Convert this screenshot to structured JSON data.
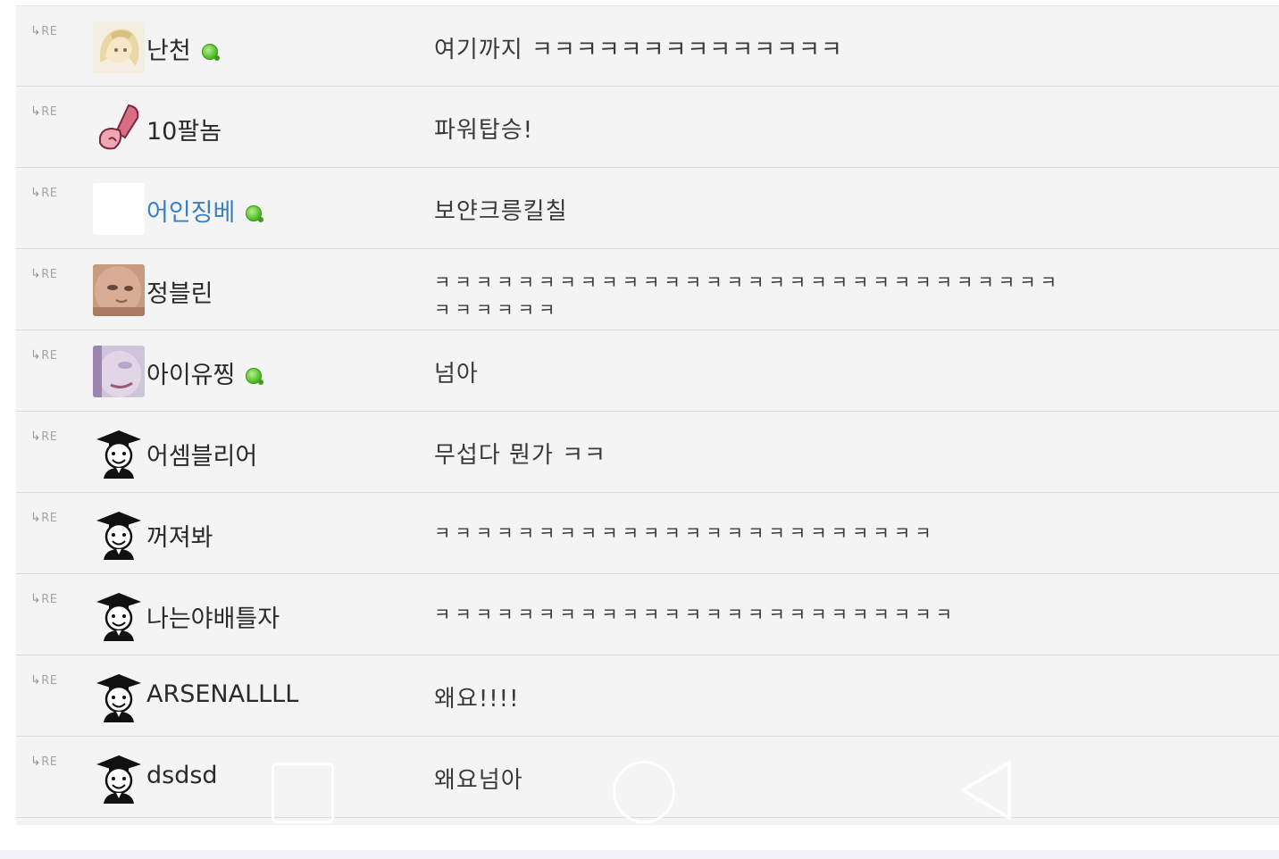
{
  "re_label": "RE",
  "comments": [
    {
      "nickname": "난천",
      "message": "여기까지 ㅋㅋㅋㅋㅋㅋㅋㅋㅋㅋㅋㅋㅋㅋ",
      "online": true,
      "avatar": "blonde-anime-avatar"
    },
    {
      "nickname": "10팔놈",
      "message": "파워탑승!",
      "online": false,
      "avatar": "pink-figure-avatar"
    },
    {
      "nickname": "어인징베",
      "message": "보얀크릉킬칠",
      "online": true,
      "avatar": "blank-avatar"
    },
    {
      "nickname": "정블린",
      "message": "ㅋㅋㅋㅋㅋㅋㅋㅋㅋㅋㅋㅋㅋㅋㅋㅋㅋㅋㅋㅋㅋㅋㅋㅋㅋㅋㅋㅋㅋㅋㅋㅋㅋㅋㅋㅋ",
      "online": false,
      "avatar": "face-photo-avatar"
    },
    {
      "nickname": "아이유찡",
      "message": "넘아",
      "online": true,
      "avatar": "purple-photo-avatar"
    },
    {
      "nickname": "어셈블리어",
      "message": "무섭다 뭔가 ㅋㅋ",
      "online": false,
      "avatar": "graduate-avatar"
    },
    {
      "nickname": "꺼져봐",
      "message": "ㅋㅋㅋㅋㅋㅋㅋㅋㅋㅋㅋㅋㅋㅋㅋㅋㅋㅋㅋㅋㅋㅋㅋㅋ",
      "online": false,
      "avatar": "graduate-avatar"
    },
    {
      "nickname": "나는야배틀자",
      "message": "ㅋㅋㅋㅋㅋㅋㅋㅋㅋㅋㅋㅋㅋㅋㅋㅋㅋㅋㅋㅋㅋㅋㅋㅋㅋ",
      "online": false,
      "avatar": "graduate-avatar"
    },
    {
      "nickname": "ARSENALLLL",
      "message": "왜요!!!!",
      "online": false,
      "avatar": "graduate-avatar"
    },
    {
      "nickname": "dsdsd",
      "message": "왜요넘아",
      "online": false,
      "avatar": "graduate-avatar"
    }
  ],
  "colors": {
    "background": "#f4f4f4",
    "divider": "#dcdcdc",
    "nickname_blue": "#3a7fc4",
    "online_green": "#55c02b"
  },
  "nav_buttons": [
    "recent-apps-icon",
    "home-icon",
    "back-icon"
  ]
}
